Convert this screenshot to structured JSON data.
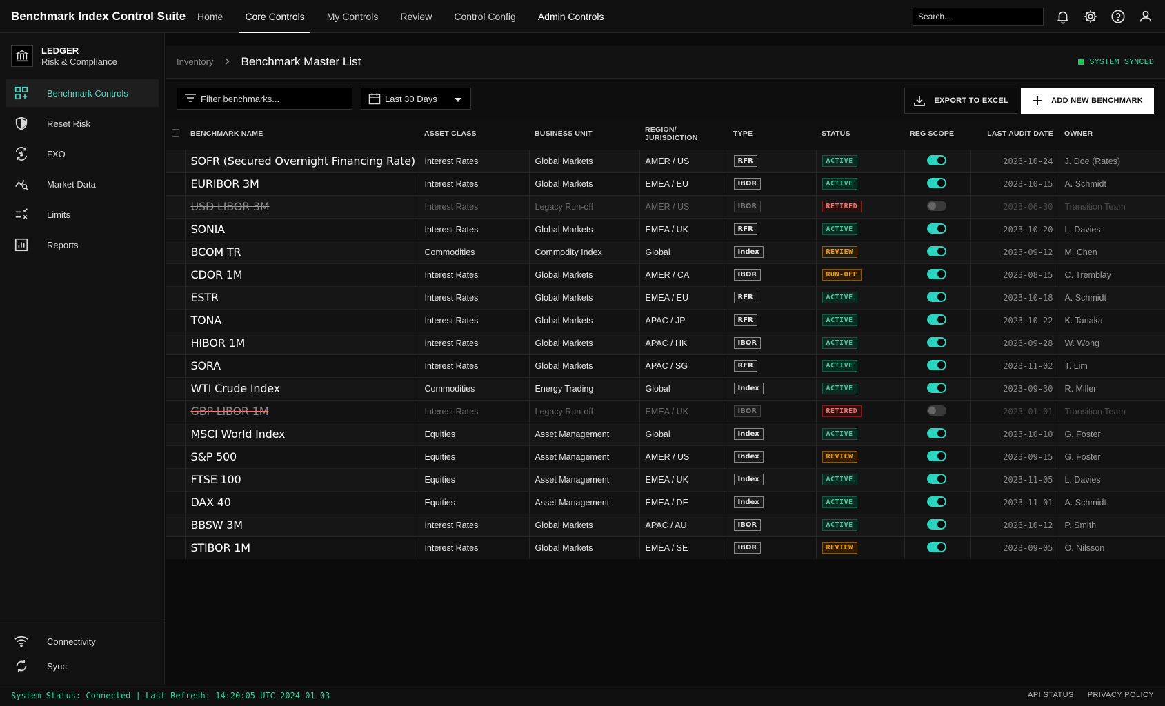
{
  "app": {
    "title": "Benchmark Index Control Suite"
  },
  "topnav": {
    "items": [
      {
        "label": "Home"
      },
      {
        "label": "Core Controls"
      },
      {
        "label": "My Controls"
      },
      {
        "label": "Review"
      },
      {
        "label": "Control Config"
      },
      {
        "label": "Admin Controls"
      }
    ],
    "active": "Core Controls",
    "search_placeholder": "Search..."
  },
  "org": {
    "name": "LEDGER",
    "subtitle": "Risk & Compliance"
  },
  "sidebar": {
    "items": [
      {
        "label": "Benchmark Controls",
        "icon": "grid-add-icon"
      },
      {
        "label": "Reset Risk",
        "icon": "shield-icon"
      },
      {
        "label": "FXO",
        "icon": "currency-exchange-icon"
      },
      {
        "label": "Market Data",
        "icon": "chart-search-icon"
      },
      {
        "label": "Limits",
        "icon": "rule-icon"
      },
      {
        "label": "Reports",
        "icon": "bar-chart-icon"
      }
    ],
    "bottom": [
      {
        "label": "Connectivity",
        "icon": "wifi-icon"
      },
      {
        "label": "Sync",
        "icon": "sync-icon"
      }
    ]
  },
  "page": {
    "breadcrumb": "Inventory",
    "title": "Benchmark Master List",
    "sync_status": "SYSTEM SYNCED"
  },
  "toolbar": {
    "filter_placeholder": "Filter benchmarks...",
    "date_range": "Last 30 Days",
    "export_label": "EXPORT TO EXCEL",
    "add_label": "ADD NEW BENCHMARK"
  },
  "table": {
    "headers": {
      "name": "Benchmark Name",
      "asset": "Asset Class",
      "unit": "Business Unit",
      "region": "Region/ Jurisdiction",
      "type": "Type",
      "status": "Status",
      "scope": "Reg Scope",
      "audit": "Last Audit Date",
      "owner": "Owner"
    },
    "rows": [
      {
        "name": "SOFR (Secured Overnight Financing Rate)",
        "asset": "Interest Rates",
        "unit": "Global Markets",
        "region": "AMER / US",
        "type": "RFR",
        "status": "ACTIVE",
        "scope": true,
        "audit": "2023-10-24",
        "owner": "J. Doe (Rates)"
      },
      {
        "name": "EURIBOR 3M",
        "asset": "Interest Rates",
        "unit": "Global Markets",
        "region": "EMEA / EU",
        "type": "IBOR",
        "status": "ACTIVE",
        "scope": true,
        "audit": "2023-10-15",
        "owner": "A. Schmidt"
      },
      {
        "name": "USD LIBOR 3M",
        "asset": "Interest Rates",
        "unit": "Legacy Run-off",
        "region": "AMER / US",
        "type": "IBOR",
        "status": "RETIRED",
        "scope": false,
        "audit": "2023-06-30",
        "owner": "Transition Team"
      },
      {
        "name": "SONIA",
        "asset": "Interest Rates",
        "unit": "Global Markets",
        "region": "EMEA / UK",
        "type": "RFR",
        "status": "ACTIVE",
        "scope": true,
        "audit": "2023-10-20",
        "owner": "L. Davies"
      },
      {
        "name": "BCOM TR",
        "asset": "Commodities",
        "unit": "Commodity Index",
        "region": "Global",
        "type": "Index",
        "status": "REVIEW",
        "scope": true,
        "audit": "2023-09-12",
        "owner": "M. Chen"
      },
      {
        "name": "CDOR 1M",
        "asset": "Interest Rates",
        "unit": "Global Markets",
        "region": "AMER / CA",
        "type": "IBOR",
        "status": "RUN-OFF",
        "scope": true,
        "audit": "2023-08-15",
        "owner": "C. Tremblay"
      },
      {
        "name": "ESTR",
        "asset": "Interest Rates",
        "unit": "Global Markets",
        "region": "EMEA / EU",
        "type": "RFR",
        "status": "ACTIVE",
        "scope": true,
        "audit": "2023-10-18",
        "owner": "A. Schmidt"
      },
      {
        "name": "TONA",
        "asset": "Interest Rates",
        "unit": "Global Markets",
        "region": "APAC / JP",
        "type": "RFR",
        "status": "ACTIVE",
        "scope": true,
        "audit": "2023-10-22",
        "owner": "K. Tanaka"
      },
      {
        "name": "HIBOR 1M",
        "asset": "Interest Rates",
        "unit": "Global Markets",
        "region": "APAC / HK",
        "type": "IBOR",
        "status": "ACTIVE",
        "scope": true,
        "audit": "2023-09-28",
        "owner": "W. Wong"
      },
      {
        "name": "SORA",
        "asset": "Interest Rates",
        "unit": "Global Markets",
        "region": "APAC / SG",
        "type": "RFR",
        "status": "ACTIVE",
        "scope": true,
        "audit": "2023-11-02",
        "owner": "T. Lim"
      },
      {
        "name": "WTI Crude Index",
        "asset": "Commodities",
        "unit": "Energy Trading",
        "region": "Global",
        "type": "Index",
        "status": "ACTIVE",
        "scope": true,
        "audit": "2023-09-30",
        "owner": "R. Miller"
      },
      {
        "name": "GBP LIBOR 1M",
        "asset": "Interest Rates",
        "unit": "Legacy Run-off",
        "region": "EMEA / UK",
        "type": "IBOR",
        "status": "RETIRED",
        "scope": false,
        "audit": "2023-01-01",
        "owner": "Transition Team"
      },
      {
        "name": "MSCI World Index",
        "asset": "Equities",
        "unit": "Asset Management",
        "region": "Global",
        "type": "Index",
        "status": "ACTIVE",
        "scope": true,
        "audit": "2023-10-10",
        "owner": "G. Foster"
      },
      {
        "name": "S&P 500",
        "asset": "Equities",
        "unit": "Asset Management",
        "region": "AMER / US",
        "type": "Index",
        "status": "REVIEW",
        "scope": true,
        "audit": "2023-09-15",
        "owner": "G. Foster"
      },
      {
        "name": "FTSE 100",
        "asset": "Equities",
        "unit": "Asset Management",
        "region": "EMEA / UK",
        "type": "Index",
        "status": "ACTIVE",
        "scope": true,
        "audit": "2023-11-05",
        "owner": "L. Davies"
      },
      {
        "name": "DAX 40",
        "asset": "Equities",
        "unit": "Asset Management",
        "region": "EMEA / DE",
        "type": "Index",
        "status": "ACTIVE",
        "scope": true,
        "audit": "2023-11-01",
        "owner": "A. Schmidt"
      },
      {
        "name": "BBSW 3M",
        "asset": "Interest Rates",
        "unit": "Global Markets",
        "region": "APAC / AU",
        "type": "IBOR",
        "status": "ACTIVE",
        "scope": true,
        "audit": "2023-10-12",
        "owner": "P. Smith"
      },
      {
        "name": "STIBOR 1M",
        "asset": "Interest Rates",
        "unit": "Global Markets",
        "region": "EMEA / SE",
        "type": "IBOR",
        "status": "REVIEW",
        "scope": true,
        "audit": "2023-09-05",
        "owner": "O. Nilsson"
      }
    ]
  },
  "footer": {
    "status": "System Status: Connected | Last Refresh: 14:20:05 UTC 2024-01-03",
    "links": [
      "API STATUS",
      "PRIVACY POLICY"
    ]
  },
  "colors": {
    "accent": "#4fd8c4",
    "active": "#34d399",
    "retired": "#f87171",
    "review": "#f59e0b",
    "toggle_on": "#2dd4bf"
  }
}
